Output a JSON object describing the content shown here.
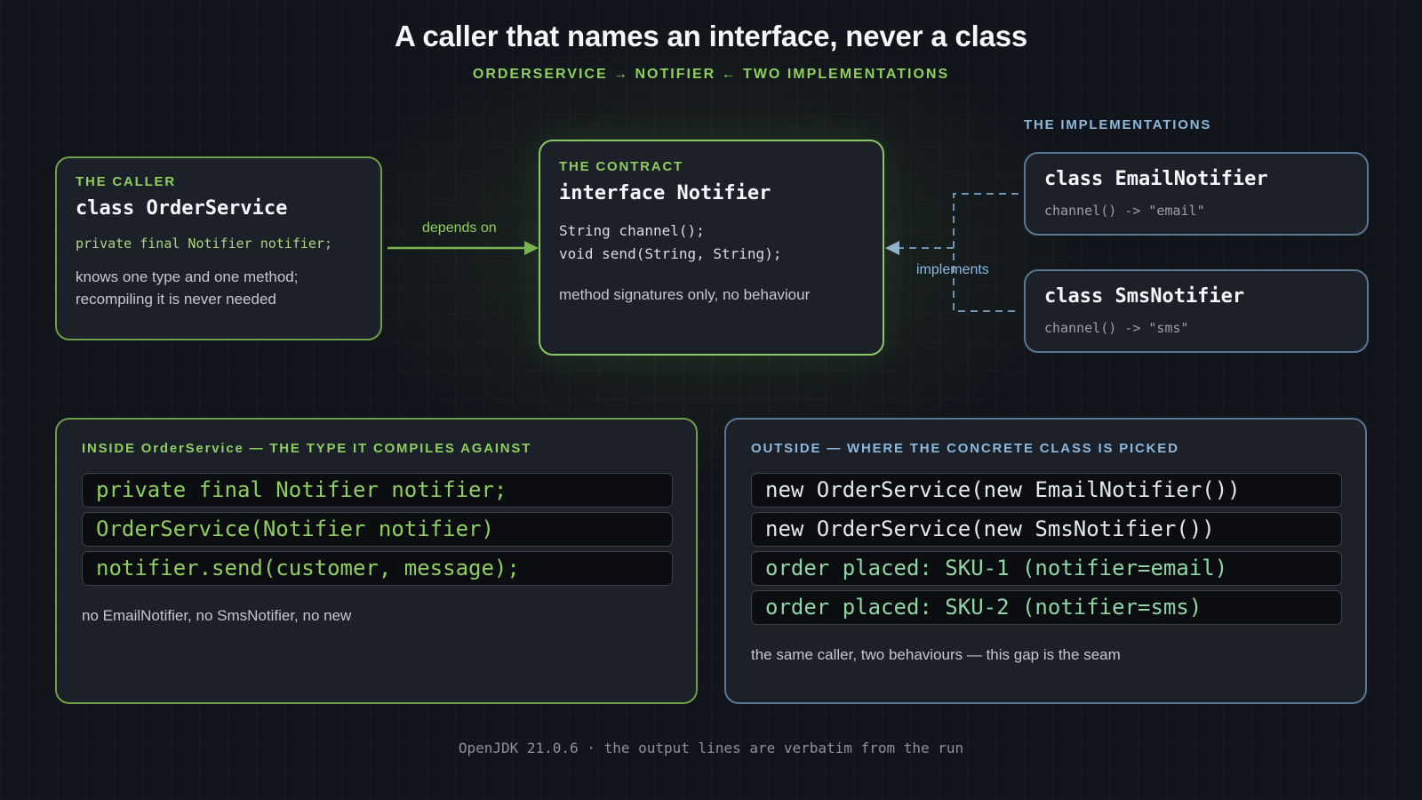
{
  "title": "A caller that names an interface, never a class",
  "subtitle": "ORDERSERVICE → NOTIFIER ← TWO IMPLEMENTATIONS",
  "caller": {
    "kicker": "THE CALLER",
    "name": "class OrderService",
    "field": "private final Notifier notifier;",
    "note_line1": "knows one type and one method;",
    "note_line2": "recompiling it is never needed"
  },
  "edges": {
    "depends_on": "depends on",
    "implements": "implements"
  },
  "contract": {
    "kicker": "THE CONTRACT",
    "name": "interface Notifier",
    "method1": "String channel();",
    "method2": "void send(String, String);",
    "note": "method signatures only, no behaviour"
  },
  "implementations": {
    "kicker": "THE IMPLEMENTATIONS",
    "email": {
      "name": "class EmailNotifier",
      "channel": "channel() -> \"email\""
    },
    "sms": {
      "name": "class SmsNotifier",
      "channel": "channel() -> \"sms\""
    }
  },
  "inside": {
    "kicker": "INSIDE OrderService — THE TYPE IT COMPILES AGAINST",
    "lines": [
      "private final Notifier notifier;",
      "OrderService(Notifier notifier)",
      "notifier.send(customer, message);"
    ],
    "note": "no EmailNotifier, no SmsNotifier, no new"
  },
  "outside": {
    "kicker": "OUTSIDE — WHERE THE CONCRETE CLASS IS PICKED",
    "lines": [
      "new OrderService(new EmailNotifier())",
      "new OrderService(new SmsNotifier())",
      "order placed: SKU-1 (notifier=email)",
      "order placed: SKU-2 (notifier=sms)"
    ],
    "note": "the same caller, two behaviours — this gap is the seam"
  },
  "footer": "OpenJDK 21.0.6 · the output lines are verbatim from the run",
  "colors": {
    "accent_green": "#8fce5e",
    "accent_blue": "#8db8db",
    "background": "#11151b"
  }
}
